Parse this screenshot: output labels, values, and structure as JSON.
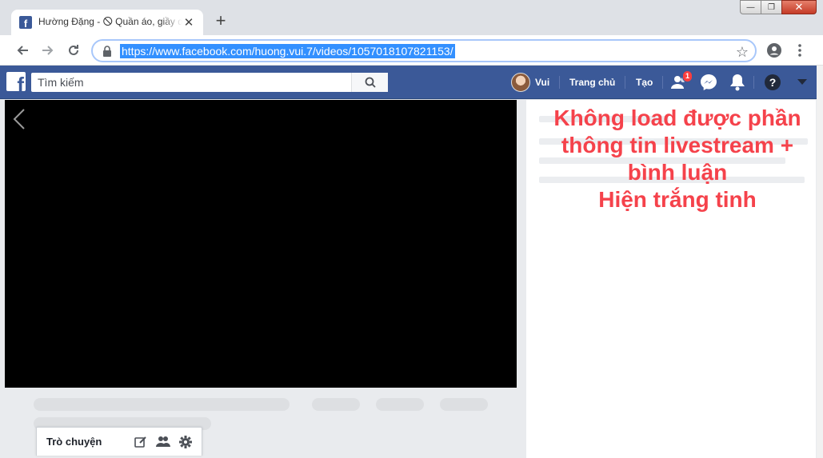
{
  "tab": {
    "title": "Hường Đặng - 🛇 Quần áo, giầy dép",
    "close": "✕",
    "new_tab": "+",
    "favicon": "f"
  },
  "window": {
    "minimize": "—",
    "maximize": "❐",
    "close": "✕"
  },
  "toolbar": {
    "url": "https://www.facebook.com/huong.vui.7/videos/1057018107821153/"
  },
  "fb": {
    "search_placeholder": "Tìm kiếm",
    "user_name": "Vui",
    "home": "Trang chủ",
    "create": "Tạo",
    "friend_requests_count": "1",
    "brand_color": "#3b5998"
  },
  "annotation": {
    "lines": [
      "Không load được phần",
      "thông tin livestream +",
      "bình luận",
      "Hiện trắng tinh"
    ],
    "color": "#f5424b"
  },
  "chat": {
    "label": "Trò chuyện"
  }
}
